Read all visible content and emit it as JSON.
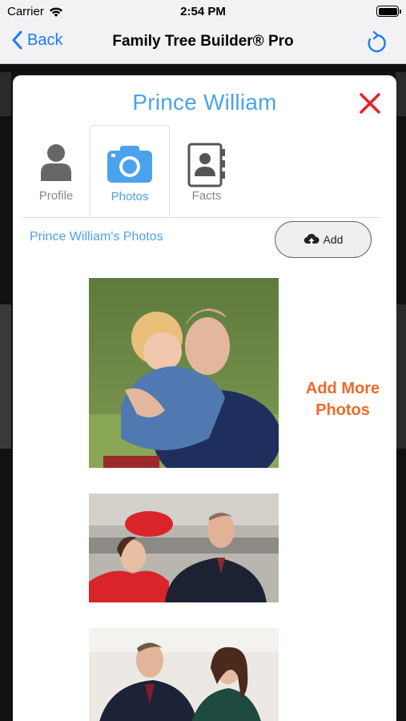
{
  "status_bar": {
    "carrier": "Carrier",
    "time": "2:54 PM"
  },
  "nav": {
    "back_label": "Back",
    "title": "Family Tree Builder® Pro"
  },
  "modal": {
    "title": "Prince William",
    "tabs": [
      {
        "label": "Profile",
        "icon": "person-icon"
      },
      {
        "label": "Photos",
        "icon": "camera-icon",
        "selected": true
      },
      {
        "label": "Facts",
        "icon": "contacts-book-icon"
      }
    ],
    "section_label": "Prince William's Photos",
    "add_button_label": "Add",
    "add_more_text": "Add More Photos",
    "photos": [
      {
        "alt": "Prince William hugging child"
      },
      {
        "alt": "Prince William and Catherine in red"
      },
      {
        "alt": "Prince William and Catherine"
      }
    ]
  },
  "colors": {
    "accent_blue": "#4aa3ec",
    "ios_blue": "#1a7cf5",
    "close_red": "#e8232b",
    "orange": "#ef6a2b"
  }
}
